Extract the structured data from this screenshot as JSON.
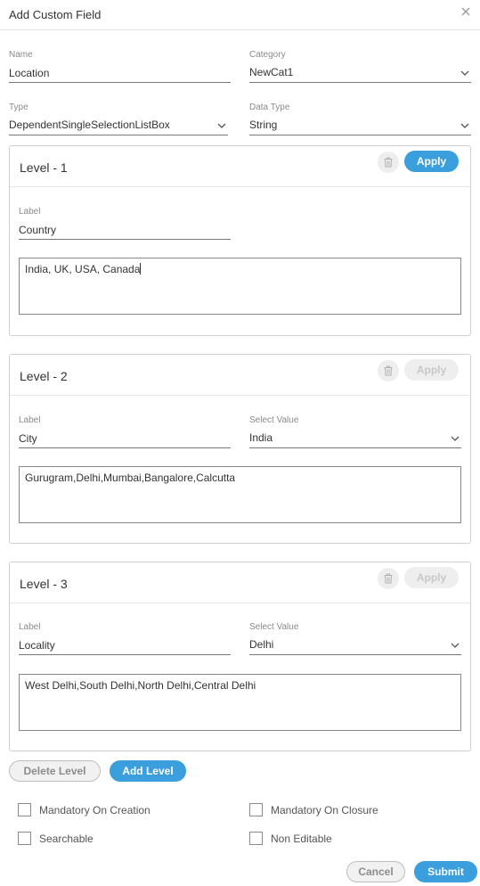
{
  "dialog": {
    "title": "Add Custom Field"
  },
  "fields": {
    "name": {
      "label": "Name",
      "value": "Location"
    },
    "category": {
      "label": "Category",
      "value": "NewCat1"
    },
    "type": {
      "label": "Type",
      "value": "DependentSingleSelectionListBox"
    },
    "data_type": {
      "label": "Data Type",
      "value": "String"
    }
  },
  "levels": [
    {
      "title": "Level - 1",
      "apply_label": "Apply",
      "apply_enabled": true,
      "label_caption": "Label",
      "label_value": "Country",
      "values": "India, UK, USA, Canada"
    },
    {
      "title": "Level - 2",
      "apply_label": "Apply",
      "apply_enabled": false,
      "label_caption": "Label",
      "label_value": "City",
      "select_caption": "Select Value",
      "select_value": "India",
      "values": "Gurugram,Delhi,Mumbai,Bangalore,Calcutta"
    },
    {
      "title": "Level - 3",
      "apply_label": "Apply",
      "apply_enabled": false,
      "label_caption": "Label",
      "label_value": "Locality",
      "select_caption": "Select Value",
      "select_value": "Delhi",
      "values": "West Delhi,South Delhi,North Delhi,Central Delhi"
    }
  ],
  "level_actions": {
    "delete_label": "Delete Level",
    "add_label": "Add Level"
  },
  "options": {
    "mandatory_on_creation": "Mandatory On Creation",
    "mandatory_on_closure": "Mandatory On Closure",
    "searchable": "Searchable",
    "non_editable": "Non Editable"
  },
  "footer": {
    "cancel_label": "Cancel",
    "submit_label": "Submit"
  },
  "colors": {
    "accent": "#3a9fdc",
    "disabled": "#eeeeee",
    "border": "#d0d0d0"
  },
  "icons": {
    "close": "close-icon",
    "trash": "trash-icon",
    "dropdown": "chevron-down-icon"
  }
}
